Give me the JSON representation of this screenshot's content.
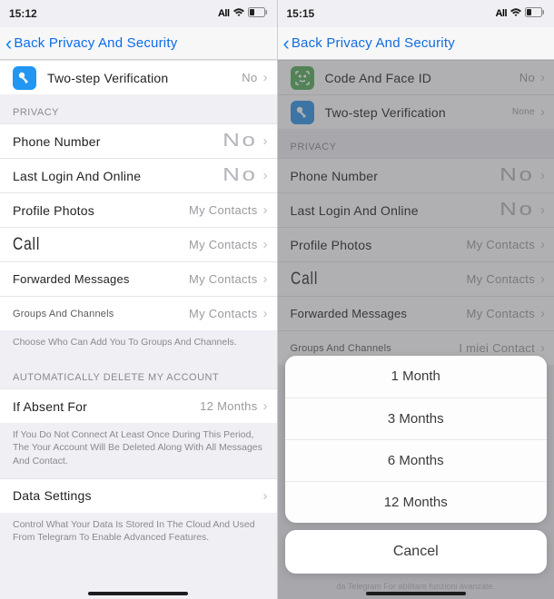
{
  "left": {
    "status": {
      "time": "15:12",
      "net": "All"
    },
    "header": {
      "back": "Back Privacy And Security"
    },
    "security": {
      "two_step": {
        "label": "Two-step Verification",
        "value": "No"
      }
    },
    "privacy_header": "Privacy",
    "privacy": {
      "phone": {
        "label": "Phone Number",
        "value": "No"
      },
      "last": {
        "label": "Last Login And Online",
        "value": "No"
      },
      "photos": {
        "label": "Profile Photos",
        "value": "My Contacts"
      },
      "call": {
        "label": "Call",
        "value": "My Contacts"
      },
      "fwd": {
        "label": "Forwarded Messages",
        "value": "My Contacts"
      },
      "groups": {
        "label": "Groups And Channels",
        "value": "My Contacts"
      }
    },
    "privacy_footer": "Choose Who Can Add You To Groups And Channels.",
    "auto_header": "Automatically Delete My Account",
    "absent": {
      "label": "If Absent For",
      "value": "12 Months"
    },
    "absent_footer": "If You Do Not Connect At Least Once During This Period, The Your Account Will Be Deleted Along With All Messages And Contact.",
    "data": {
      "label": "Data Settings"
    },
    "data_footer": "Control What Your Data Is Stored In The Cloud And Used From Telegram To Enable Advanced Features."
  },
  "right": {
    "status": {
      "time": "15:15",
      "net": "All"
    },
    "header": {
      "back": "Back Privacy And Security"
    },
    "security": {
      "code": {
        "label": "Code And Face ID",
        "value": "No"
      },
      "two_step": {
        "label": "Two-step Verification",
        "value": "None"
      }
    },
    "privacy_header": "Privacy",
    "privacy": {
      "phone": {
        "label": "Phone Number",
        "value": "No"
      },
      "last": {
        "label": "Last Login And Online",
        "value": "No"
      },
      "photos": {
        "label": "Profile Photos",
        "value": "My Contacts"
      },
      "call": {
        "label": "Call",
        "value": "My Contacts"
      },
      "fwd": {
        "label": "Forwarded Messages",
        "value": "My Contacts"
      },
      "groups": {
        "label": "Groups And Channels",
        "value": "I miei Contact"
      }
    },
    "absent_footer_partial": "da Telegram For abilitare funzioni avanzate.",
    "sheet": {
      "options": [
        "1 Month",
        "3 Months",
        "6 Months",
        "12 Months"
      ],
      "cancel": "Cancel"
    }
  }
}
